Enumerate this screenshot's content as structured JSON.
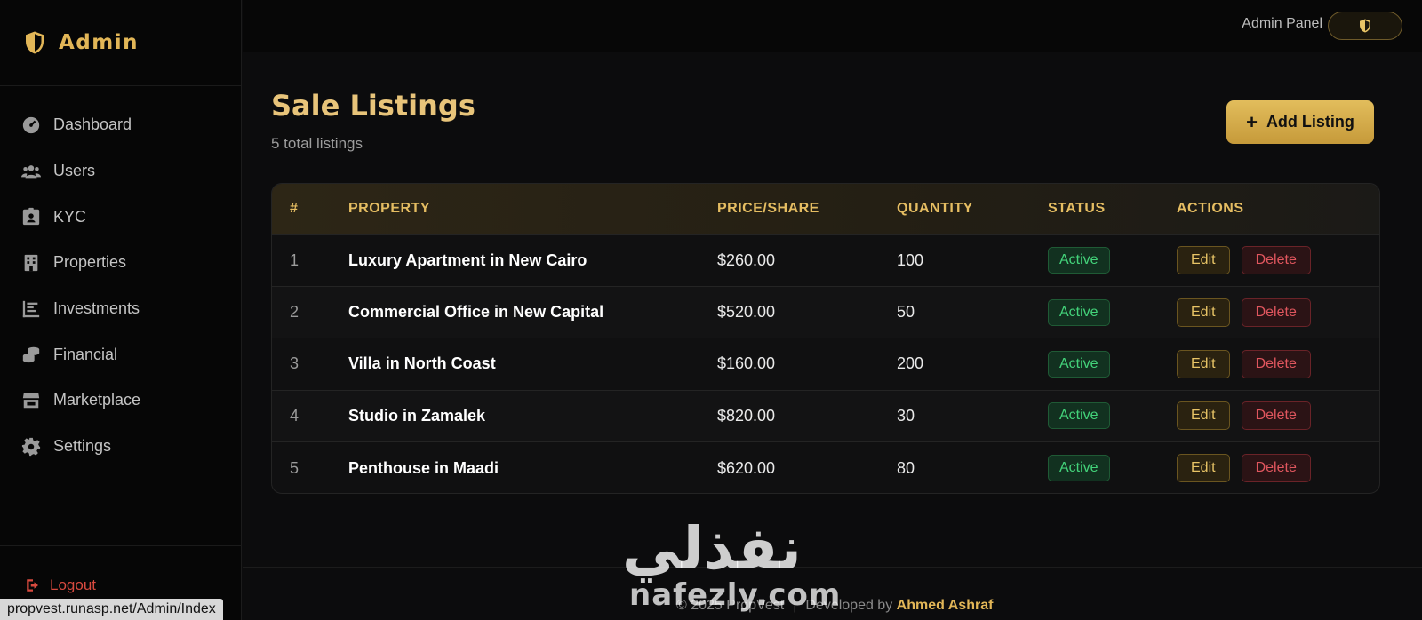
{
  "sidebar": {
    "brand": "Admin",
    "items": [
      {
        "label": "Dashboard",
        "icon": "gauge-icon"
      },
      {
        "label": "Users",
        "icon": "users-icon"
      },
      {
        "label": "KYC",
        "icon": "id-card-icon"
      },
      {
        "label": "Properties",
        "icon": "building-icon"
      },
      {
        "label": "Investments",
        "icon": "chart-icon"
      },
      {
        "label": "Financial",
        "icon": "coins-icon"
      },
      {
        "label": "Marketplace",
        "icon": "store-icon"
      },
      {
        "label": "Settings",
        "icon": "gear-icon"
      }
    ],
    "logout": "Logout"
  },
  "topbar": {
    "admin_label": "Admin Panel"
  },
  "page": {
    "title": "Sale Listings",
    "subtitle": "5 total listings",
    "add_button": "Add Listing"
  },
  "table": {
    "headers": [
      "#",
      "PROPERTY",
      "PRICE/SHARE",
      "QUANTITY",
      "STATUS",
      "ACTIONS"
    ],
    "rows": [
      {
        "idx": "1",
        "property": "Luxury Apartment in New Cairo",
        "price": "$260.00",
        "quantity": "100",
        "status": "Active"
      },
      {
        "idx": "2",
        "property": "Commercial Office in New Capital",
        "price": "$520.00",
        "quantity": "50",
        "status": "Active"
      },
      {
        "idx": "3",
        "property": "Villa in North Coast",
        "price": "$160.00",
        "quantity": "200",
        "status": "Active"
      },
      {
        "idx": "4",
        "property": "Studio in Zamalek",
        "price": "$820.00",
        "quantity": "30",
        "status": "Active"
      },
      {
        "idx": "5",
        "property": "Penthouse in Maadi",
        "price": "$620.00",
        "quantity": "80",
        "status": "Active"
      }
    ],
    "edit_label": "Edit",
    "delete_label": "Delete"
  },
  "footer": {
    "copyright": "© 2025 PropVest",
    "developed_by": "Developed by",
    "author": "Ahmed Ashraf"
  },
  "watermark": {
    "arabic": "نفذلي",
    "latin": "nafezly.com"
  },
  "status_bar": {
    "url": "propvest.runasp.net/Admin/Index"
  },
  "colors": {
    "accent": "#e2b657",
    "active": "#43d37a",
    "danger": "#e0565e"
  }
}
